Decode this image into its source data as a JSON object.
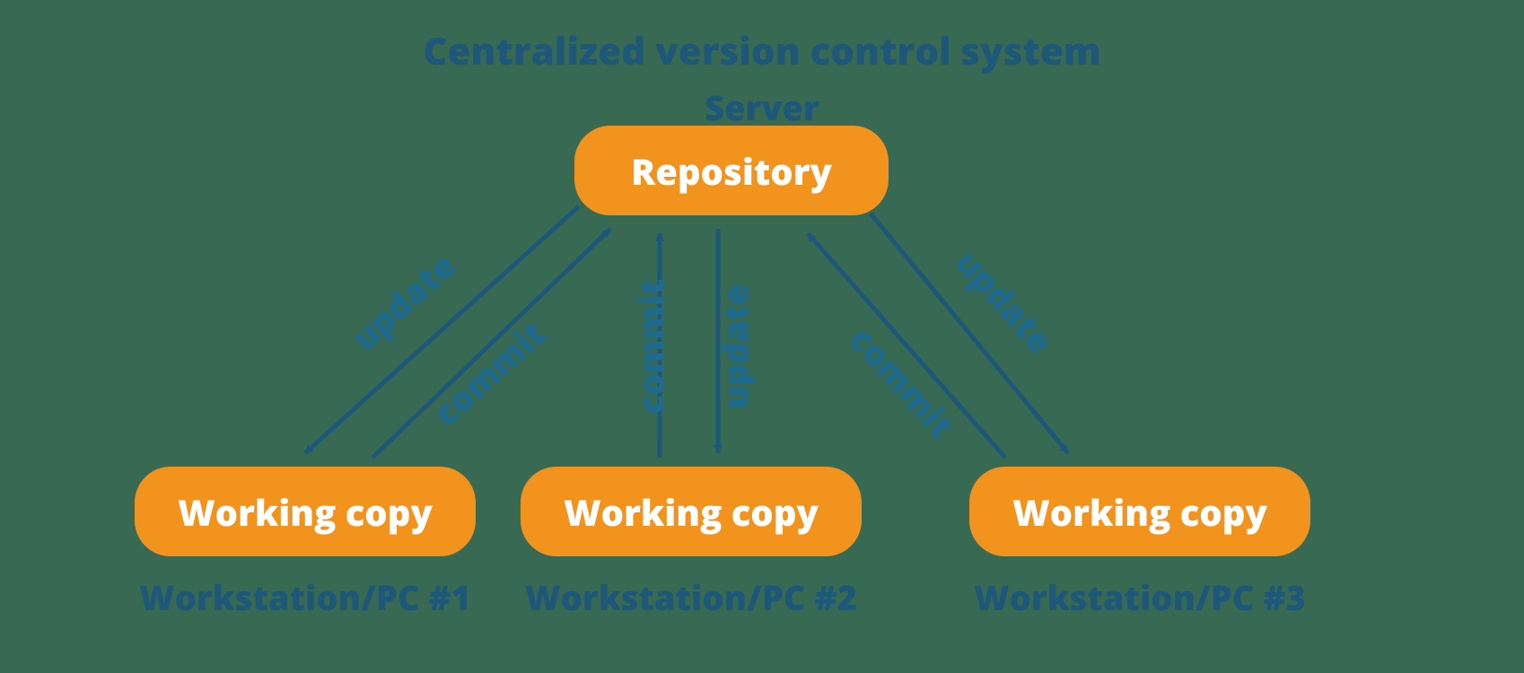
{
  "title": "Centralized version control system",
  "server_label": "Server",
  "repository_label": "Repository",
  "workstations": [
    {
      "box_label": "Working copy",
      "caption": "Workstation/PC #1"
    },
    {
      "box_label": "Working copy",
      "caption": "Workstation/PC #2"
    },
    {
      "box_label": "Working copy",
      "caption": "Workstation/PC #3"
    }
  ],
  "edge_labels": {
    "update": "update",
    "commit": "commit"
  },
  "colors": {
    "background": "#386a53",
    "box_fill": "#f2931e",
    "text_dark": "#1d587a",
    "arrow": "#1d587a"
  }
}
